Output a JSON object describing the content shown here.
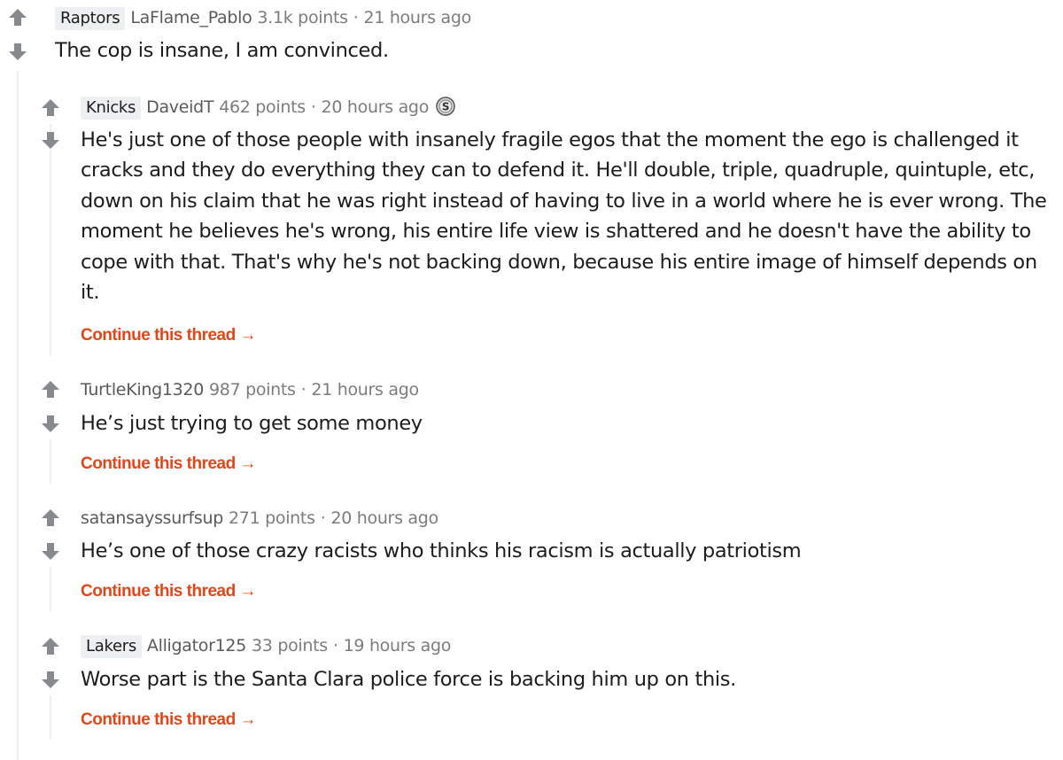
{
  "comments": [
    {
      "flair": "Raptors",
      "author": "LaFlame_Pablo",
      "points": "3.1k points",
      "separator": "·",
      "time": "21 hours ago",
      "body": "The cop is insane, I am convinced."
    },
    {
      "flair": "Knicks",
      "author": "DaveidT",
      "points": "462 points",
      "separator": "·",
      "time": "20 hours ago",
      "award": "silver-coin-icon",
      "body": "He's just one of those people with insanely fragile egos that the moment the ego is challenged it cracks and they do everything they can to defend it. He'll double, triple, quadruple, quintuple, etc, down on his claim that he was right instead of having to live in a world where he is ever wrong. The moment he believes he's wrong, his entire life view is shattered and he doesn't have the ability to cope with that. That's why he's not backing down, because his entire image of himself depends on it.",
      "continue": "Continue this thread →"
    },
    {
      "author": "TurtleKing1320",
      "points": "987 points",
      "separator": "·",
      "time": "21 hours ago",
      "body": "He’s just trying to get some money",
      "continue": "Continue this thread →"
    },
    {
      "author": "satansayssurfsup",
      "points": "271 points",
      "separator": "·",
      "time": "20 hours ago",
      "body": "He’s one of those crazy racists who thinks his racism is actually patriotism",
      "continue": "Continue this thread →"
    },
    {
      "flair": "Lakers",
      "author": "Alligator125",
      "points": "33 points",
      "separator": "·",
      "time": "19 hours ago",
      "body": "Worse part is the Santa Clara police force is backing him up on this.",
      "continue": "Continue this thread →"
    }
  ],
  "colors": {
    "accent": "#e0471b",
    "arrow": "#878a8c",
    "meta": "#7c7c7c",
    "flair_bg": "#edeff1",
    "thread_line": "#edeff1"
  }
}
